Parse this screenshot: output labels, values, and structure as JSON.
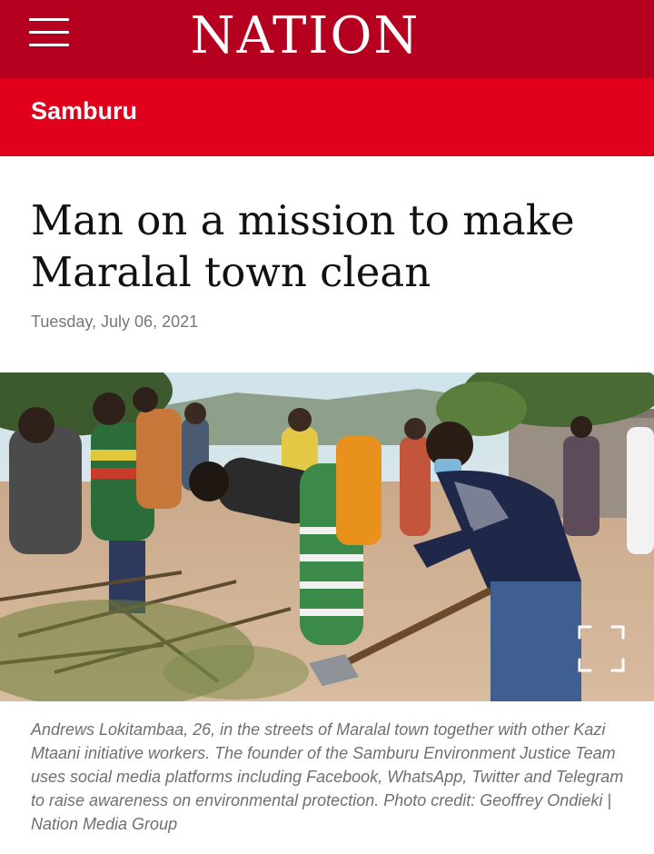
{
  "header": {
    "menu_icon": "hamburger-menu-icon",
    "logo_text": "NATION",
    "brand_color": "#b5001f"
  },
  "section": {
    "label": "Samburu",
    "color": "#e0001b"
  },
  "article": {
    "headline": "Man on a mission to make Maralal town clean",
    "date": "Tuesday, July 06, 2021",
    "image": {
      "expand_icon": "fullscreen-expand-icon"
    },
    "caption": "Andrews Lokitambaa, 26, in the streets of Maralal town together with other Kazi Mtaani initiative workers. The founder of the Samburu Environment Justice Team uses social media platforms including Facebook, WhatsApp, Twitter and Telegram to raise awareness on environmental protection. Photo credit: Geoffrey Ondieki | Nation Media Group"
  }
}
